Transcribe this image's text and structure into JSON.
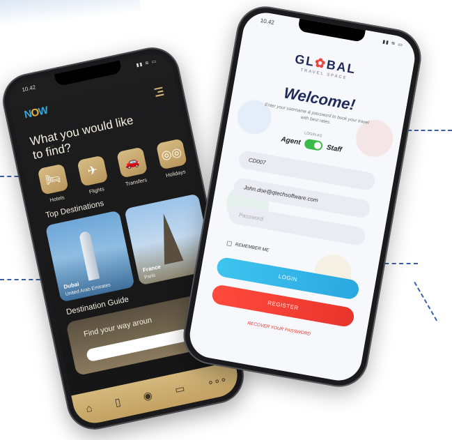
{
  "left_phone": {
    "status_time": "10.42",
    "logo": "NOW",
    "headline": "What you would like to find?",
    "categories": [
      {
        "label": "Hotels",
        "icon": "bed-icon"
      },
      {
        "label": "Flights",
        "icon": "plane-icon"
      },
      {
        "label": "Transfers",
        "icon": "car-icon"
      },
      {
        "label": "Holidays",
        "icon": "binoculars-icon"
      }
    ],
    "top_destinations_title": "Top Destinations",
    "destinations": [
      {
        "name": "Dubai",
        "country": "United Arab Emirates"
      },
      {
        "name": "France",
        "country": "Paris"
      }
    ],
    "guide_title": "Destination Guide",
    "guide_text": "Find your way aroun",
    "tabs": [
      "home-icon",
      "luggage-icon",
      "profile-icon",
      "wallet-icon",
      "more-icon"
    ]
  },
  "right_phone": {
    "status_time": "10.42",
    "logo": "GL",
    "logo_rest": "BAL",
    "logo_sub": "TRAVEL SPACE",
    "welcome": "Welcome!",
    "welcome_sub": "Enter your username & password to book your travel with best rates.",
    "login_as": "LOGIN AS",
    "role_left": "Agent",
    "role_right": "Staff",
    "agency_code": "CD007",
    "email": "John.doe@qtechsoftware.com",
    "password_placeholder": "Password",
    "remember_me": "REMEMBER ME",
    "login_button": "LOGIN",
    "register_button": "REGISTER",
    "recover_link": "RECOVER YOUR PASSWORD"
  }
}
